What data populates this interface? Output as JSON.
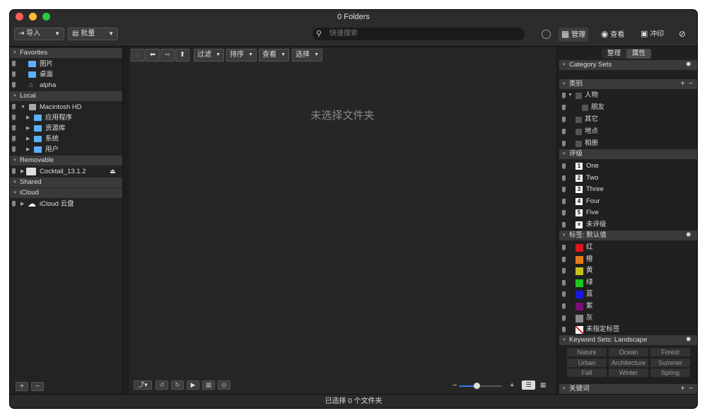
{
  "window": {
    "title": "0 Folders"
  },
  "toolbar": {
    "import_label": "导入",
    "batch_label": "批量",
    "search_placeholder": "快速搜索",
    "manage_label": "管理",
    "view_label": "查看",
    "print_label": "冲印"
  },
  "sidebar": {
    "favorites_title": "Favorites",
    "favorites": [
      "图片",
      "桌面",
      "alpha"
    ],
    "local_title": "Local",
    "local_root": "Macintosh HD",
    "local_children": [
      "应用程序",
      "资源库",
      "系统",
      "用户"
    ],
    "removable_title": "Removable",
    "removable_item": "Cocktail_13.1.2",
    "shared_title": "Shared",
    "icloud_title": "iCloud",
    "icloud_item": "iCloud 云盘"
  },
  "center": {
    "filter_label": "过滤",
    "sort_label": "排序",
    "view_label": "查看",
    "select_label": "选择",
    "empty_message": "未选择文件夹",
    "zoom": 0.4
  },
  "status": {
    "text": "已选择 0 个文件夹"
  },
  "right": {
    "tab_organize": "整理",
    "tab_properties": "属性",
    "category_sets_title": "Category Sets",
    "category_title": "类别",
    "categories": [
      "人物",
      "朋友",
      "其它",
      "地点",
      "相册"
    ],
    "rating_title": "评级",
    "ratings": [
      {
        "num": "1",
        "label": "One"
      },
      {
        "num": "2",
        "label": "Two"
      },
      {
        "num": "3",
        "label": "Three"
      },
      {
        "num": "4",
        "label": "Four"
      },
      {
        "num": "5",
        "label": "Five"
      },
      {
        "num": "✕",
        "label": "未评级"
      }
    ],
    "labels_title": "标签: 默认值",
    "labels": [
      {
        "label": "红",
        "color": "#e0151a"
      },
      {
        "label": "橙",
        "color": "#e67b16"
      },
      {
        "label": "黄",
        "color": "#c8c11c"
      },
      {
        "label": "绿",
        "color": "#1ec51e"
      },
      {
        "label": "蓝",
        "color": "#1818e0"
      },
      {
        "label": "紫",
        "color": "#7a0f7a"
      },
      {
        "label": "灰",
        "color": "#8a8a8a"
      },
      {
        "label": "未指定标签",
        "color": "#ffffff"
      }
    ],
    "keyword_sets_title": "Keyword Sets: Landscape",
    "keywords": [
      "Nature",
      "Ocean",
      "Forest",
      "Urban",
      "Architecture",
      "Summer",
      "Fall",
      "Winter",
      "Spring"
    ],
    "keywords_title": "关键词"
  },
  "colors": {
    "red": "#ff5f57",
    "yellow": "#febc2e",
    "green": "#28c840",
    "accent": "#2d7df6"
  }
}
